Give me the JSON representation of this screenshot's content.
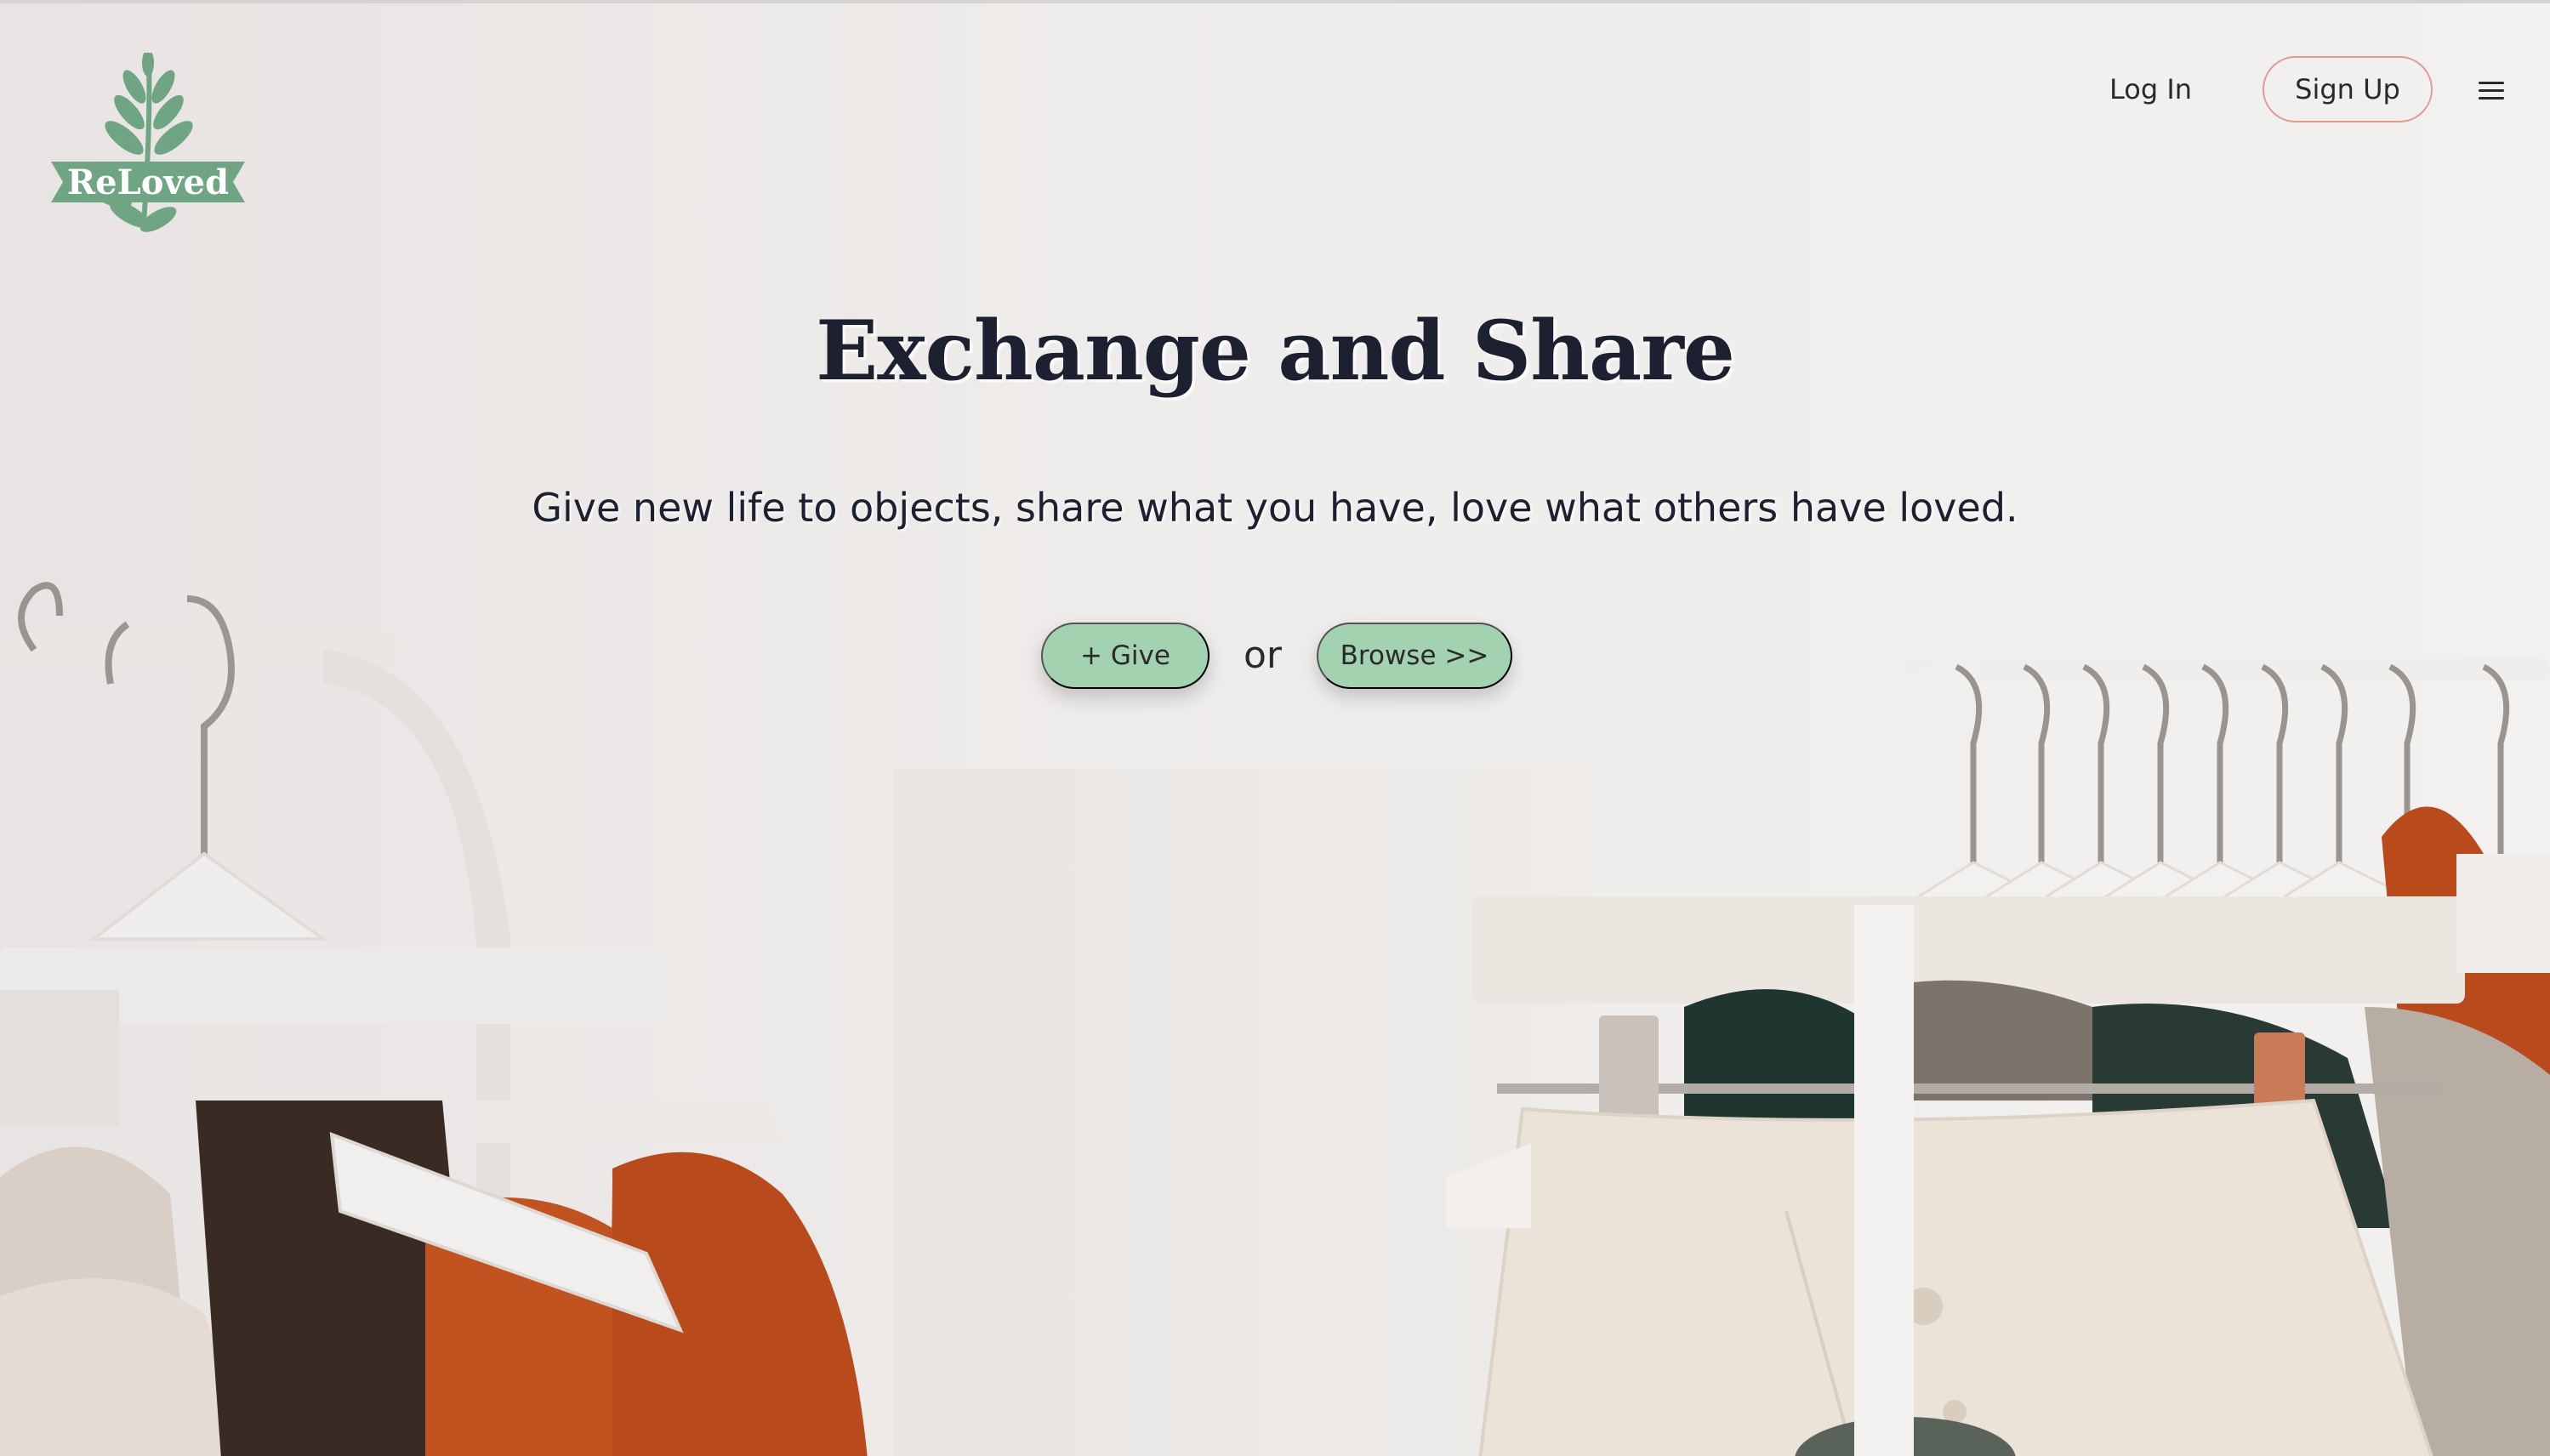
{
  "brand": {
    "logo_text": "ReLoved",
    "logo_color": "#6fa583"
  },
  "nav": {
    "login_label": "Log In",
    "signup_label": "Sign Up",
    "menu_icon": "hamburger-menu-icon"
  },
  "hero": {
    "title": "Exchange and Share",
    "subtitle": "Give new life to objects, share what you have, love what others have loved.",
    "give_label": "+ Give",
    "or_label": "or",
    "browse_label": "Browse >>"
  },
  "colors": {
    "accent_green": "#a3d2b1",
    "signup_border": "#e09a92",
    "text_dark": "#1c2030",
    "orange_garment": "#b84a1c"
  }
}
